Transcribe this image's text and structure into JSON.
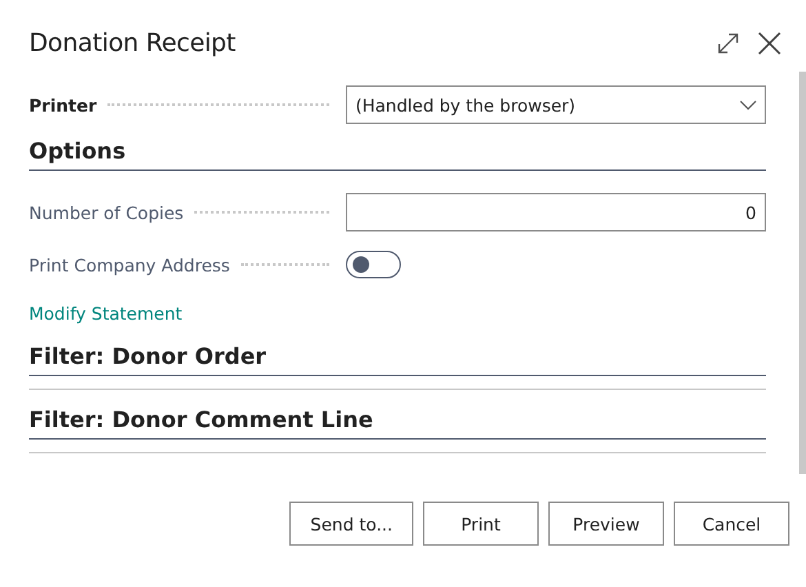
{
  "window": {
    "title": "Donation Receipt"
  },
  "printer": {
    "label": "Printer",
    "value": "(Handled by the browser)"
  },
  "options": {
    "title": "Options",
    "fields": [
      {
        "kind": "number",
        "label": "Number of Copies",
        "value": "0"
      },
      {
        "kind": "toggle",
        "label": "Print Company Address",
        "on": false
      }
    ],
    "link": "Modify Statement"
  },
  "filters": [
    {
      "title": "Filter: Donor Order"
    },
    {
      "title": "Filter: Donor Comment Line"
    }
  ],
  "buttons": [
    "Send to...",
    "Print",
    "Preview",
    "Cancel"
  ]
}
